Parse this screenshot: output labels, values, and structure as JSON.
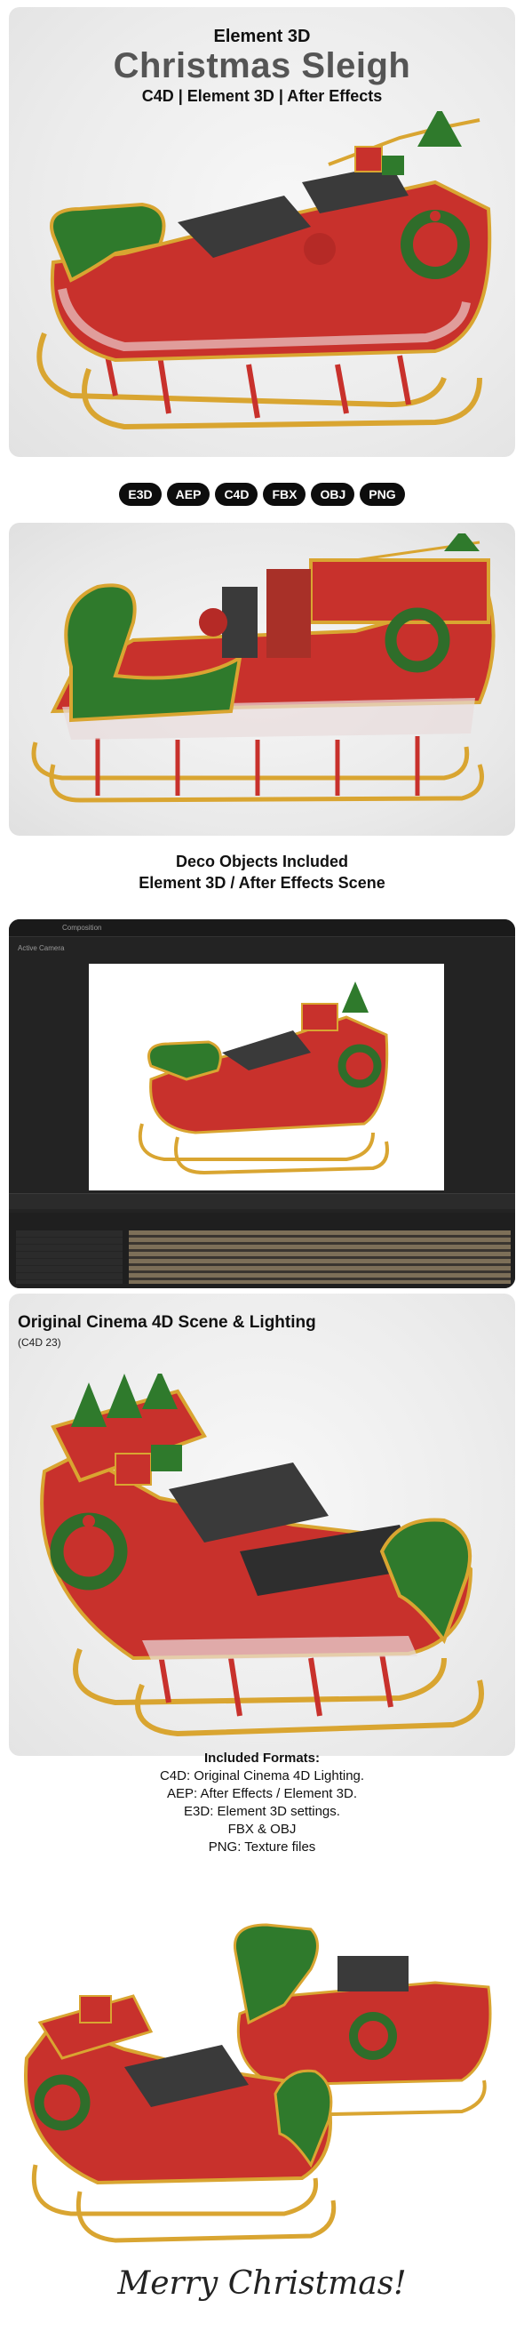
{
  "header": {
    "eyebrow": "Element 3D",
    "title": "Christmas Sleigh",
    "subtitle": "C4D | Element 3D | After Effects"
  },
  "badges": [
    "E3D",
    "AEP",
    "C4D",
    "FBX",
    "OBJ",
    "PNG"
  ],
  "caption_deco": {
    "line1": "Deco Objects Included",
    "line2": "Element 3D / After Effects Scene"
  },
  "ae": {
    "menu_label": "Composition",
    "comp_tab": "Active Camera"
  },
  "c4d_caption": {
    "title": "Original Cinema 4D Scene & Lighting",
    "version": "(C4D 23)"
  },
  "formats": {
    "heading": "Included Formats:",
    "lines": [
      "C4D: Original Cinema 4D Lighting.",
      "AEP: After Effects / Element 3D.",
      "E3D: Element 3D settings.",
      "FBX & OBJ",
      "PNG: Texture files"
    ]
  },
  "closing": "Merry Christmas!",
  "colors": {
    "sleigh_red": "#c8312c",
    "sleigh_green": "#2f7a2c",
    "gold": "#d9a531",
    "badge_bg": "#0d0d0d"
  }
}
